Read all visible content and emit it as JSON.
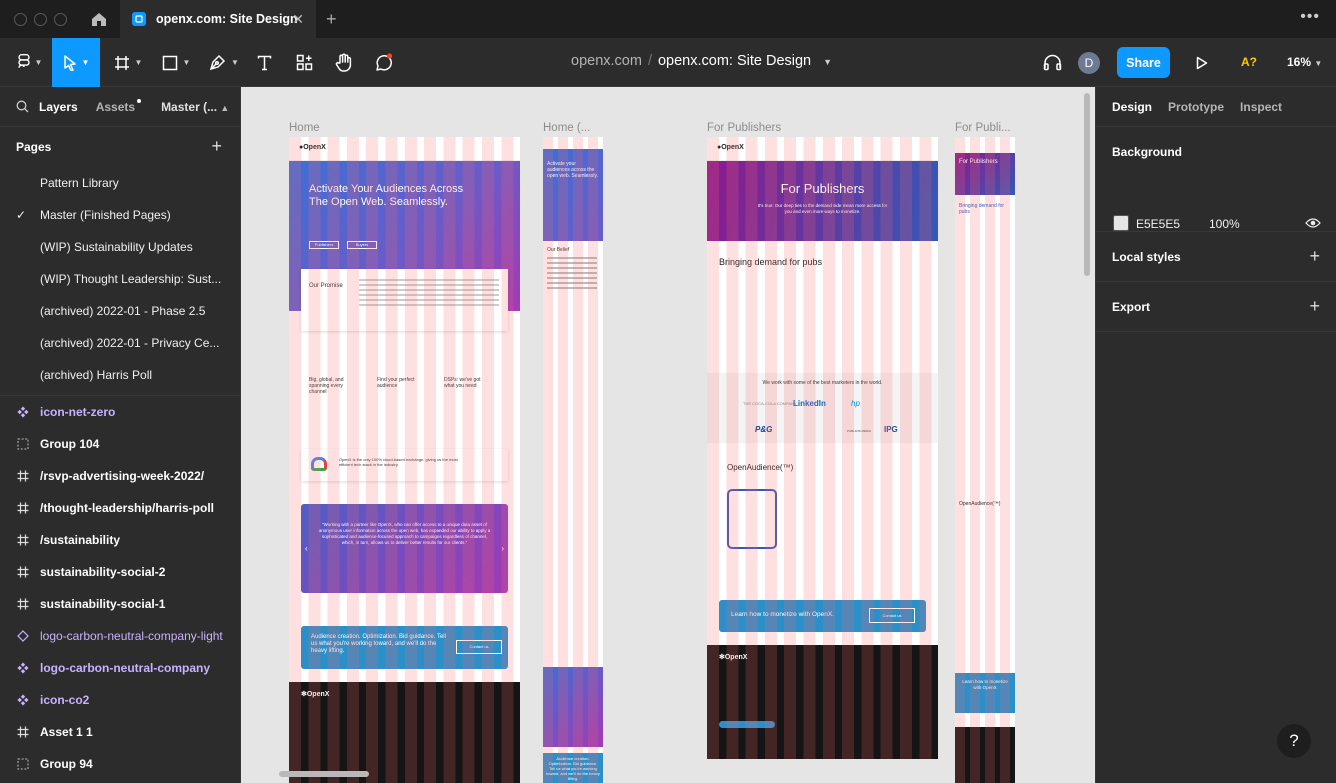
{
  "tab": {
    "title": "openx.com: Site Design"
  },
  "toolbar": {
    "project": "openx.com",
    "file": "openx.com: Site Design",
    "share": "Share",
    "avatar": "D",
    "aq": "A?",
    "zoom": "16%"
  },
  "left_panel": {
    "tabs": {
      "layers": "Layers",
      "assets": "Assets",
      "page": "Master (..."
    },
    "pages_title": "Pages",
    "pages": [
      {
        "label": "Pattern Library",
        "checked": false
      },
      {
        "label": "Master (Finished Pages)",
        "checked": true
      },
      {
        "label": "(WIP) Sustainability Updates",
        "checked": false
      },
      {
        "label": "(WIP) Thought Leadership: Sust...",
        "checked": false
      },
      {
        "label": "(archived) 2022-01 - Phase 2.5",
        "checked": false
      },
      {
        "label": "(archived) 2022-01 - Privacy Ce...",
        "checked": false
      },
      {
        "label": "(archived) Harris Poll",
        "checked": false
      }
    ],
    "layers": [
      {
        "label": "icon-net-zero",
        "icon": "component-icon",
        "type": "component"
      },
      {
        "label": "Group 104",
        "icon": "group-icon",
        "type": "group"
      },
      {
        "label": "/rsvp-advertising-week-2022/",
        "icon": "frame-icon",
        "type": "frame"
      },
      {
        "label": "/thought-leadership/harris-poll",
        "icon": "frame-icon",
        "type": "frame"
      },
      {
        "label": "/sustainability",
        "icon": "frame-icon",
        "type": "frame"
      },
      {
        "label": "sustainability-social-2",
        "icon": "frame-icon",
        "type": "frame"
      },
      {
        "label": "sustainability-social-1",
        "icon": "frame-icon",
        "type": "frame"
      },
      {
        "label": "logo-carbon-neutral-company-light",
        "icon": "instance-icon",
        "type": "component-light"
      },
      {
        "label": "logo-carbon-neutral-company",
        "icon": "component-icon",
        "type": "component"
      },
      {
        "label": "icon-co2",
        "icon": "component-icon",
        "type": "component"
      },
      {
        "label": "Asset 1 1",
        "icon": "frame-icon",
        "type": "frame"
      },
      {
        "label": "Group 94",
        "icon": "group-icon",
        "type": "group"
      }
    ]
  },
  "canvas": {
    "frames": [
      {
        "label": "Home",
        "hero_title": "Activate Your Audiences Across The Open Web. Seamlessly.",
        "promise": "Our Promise",
        "feature_1": "Big, global, and spanning every channel",
        "feature_2": "Find your perfect audience",
        "feature_3": "DSPs: we've got what you need",
        "cloud_text": "OpenX is the only 100% cloud-based exchange, giving us the most efficient tech stack in the industry.",
        "quote": "\"Working with a partner like OpenX, who can offer access to a unique data asset of anonymous user information across the open web, has expanded our ability to apply a sophisticated and audience-focused approach to campaigns regardless of channel, which, in turn, allows us to deliver better results for our clients.\"",
        "cta": "Audience creation. Optimization. Bid guidance. Tell us what you're working toward, and we'll do the heavy lifting.",
        "cta_btn": "Contact us",
        "btn_publishers": "Publishers",
        "btn_buyers": "Buyers"
      },
      {
        "label": "Home (...",
        "hero_title": "Activate your audiences across the open web. Seamlessly.",
        "belief": "Our Belief",
        "cta": "Audience creation. Optimization. Bid guidance. Tell us what you're working toward, and we'll do the heavy lifting."
      },
      {
        "label": "For Publishers",
        "hero_title": "For Publishers",
        "hero_sub": "It's true: Our deep ties to the demand side mean more access for you and even more ways to monetize.",
        "section": "Bringing demand for pubs",
        "marketers": "We work with some of the best marketers in the world.",
        "audience": "OpenAudience(™)",
        "cta": "Learn how to monetize with OpenX.",
        "cta_btn": "Contact us",
        "logos": [
          "THE COCA-COLA COMPANY",
          "LinkedIn",
          "hp",
          "P&G",
          "IPG",
          "PUBLICIS MEDIA"
        ]
      },
      {
        "label": "For Publi...",
        "hero_title": "For Publishers",
        "section": "Bringing demand for pubs",
        "audience": "OpenAudience(™)",
        "cta": "Learn how to monetize with OpenX"
      }
    ]
  },
  "right_panel": {
    "tabs": {
      "design": "Design",
      "prototype": "Prototype",
      "inspect": "Inspect"
    },
    "background_title": "Background",
    "background_hex": "E5E5E5",
    "background_opacity": "100%",
    "swatch_color": "#e5e5e5",
    "local_styles": "Local styles",
    "export": "Export"
  },
  "help": "?",
  "colors": {
    "accent": "#0d99ff",
    "component": "#c7b2ff",
    "canvas": "#e5e5e5"
  }
}
